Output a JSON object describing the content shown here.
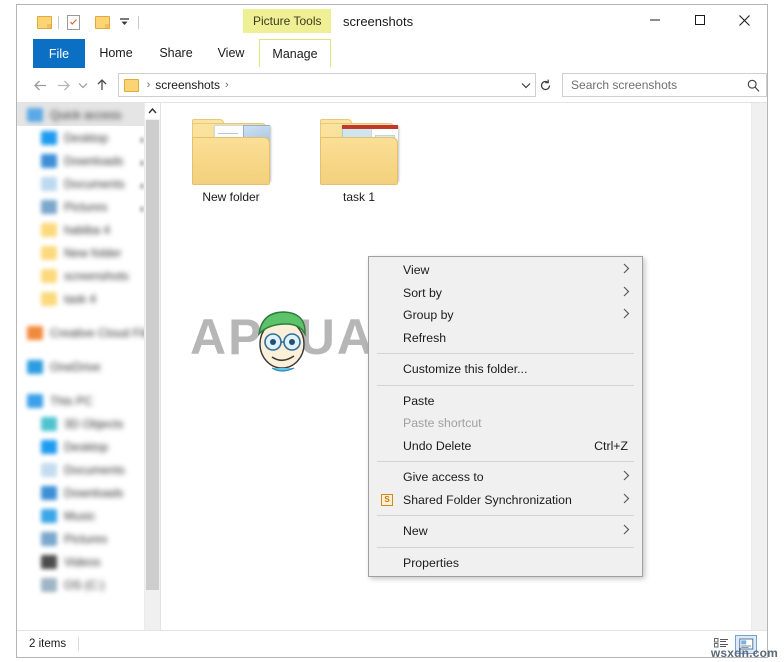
{
  "window": {
    "title": "screenshots",
    "contextual_tab_group": "Picture Tools",
    "controls": {
      "minimize": "—",
      "maximize": "□",
      "close": "✕",
      "ribbon_collapse": "⌄",
      "help": "?"
    }
  },
  "quick_access_toolbar": {
    "items": [
      {
        "name": "folder-icon",
        "label": ""
      },
      {
        "name": "properties-icon",
        "label": ""
      },
      {
        "name": "new-folder-icon",
        "label": ""
      },
      {
        "name": "customize-dropdown-icon",
        "label": "▾"
      }
    ]
  },
  "ribbon": {
    "tabs": [
      {
        "label": "File",
        "state": "file"
      },
      {
        "label": "Home",
        "state": "normal"
      },
      {
        "label": "Share",
        "state": "normal"
      },
      {
        "label": "View",
        "state": "normal"
      },
      {
        "label": "Manage",
        "state": "contextual"
      }
    ]
  },
  "navigation": {
    "back": "←",
    "forward": "→",
    "recent": "⌄",
    "up": "↑"
  },
  "address_bar": {
    "crumbs": [
      "screenshots"
    ],
    "separator": "›",
    "dropdown": "⌄",
    "refresh": "↻"
  },
  "search": {
    "placeholder": "Search screenshots",
    "icon": "⚲"
  },
  "nav_pane": {
    "items": [
      {
        "label": "Quick access",
        "level": 0,
        "icon_color": "#5aa9e6",
        "selected": true,
        "pinned": false
      },
      {
        "label": "Desktop",
        "level": 1,
        "icon_color": "#1e9bf0",
        "selected": false,
        "pinned": true
      },
      {
        "label": "Downloads",
        "level": 1,
        "icon_color": "#3d8fd6",
        "selected": false,
        "pinned": true
      },
      {
        "label": "Documents",
        "level": 1,
        "icon_color": "#bcd9ef",
        "selected": false,
        "pinned": true
      },
      {
        "label": "Pictures",
        "level": 1,
        "icon_color": "#7aa7cc",
        "selected": false,
        "pinned": true
      },
      {
        "label": "habiba 4",
        "level": 1,
        "icon_color": "#fbd97c",
        "selected": false,
        "pinned": false
      },
      {
        "label": "New folder",
        "level": 1,
        "icon_color": "#fbd97c",
        "selected": false,
        "pinned": false
      },
      {
        "label": "screenshots",
        "level": 1,
        "icon_color": "#fbd97c",
        "selected": false,
        "pinned": false
      },
      {
        "label": "task 4",
        "level": 1,
        "icon_color": "#fbd97c",
        "selected": false,
        "pinned": false
      },
      {
        "label": "Creative Cloud Files",
        "level": 0,
        "icon_color": "#f08a3c",
        "selected": false,
        "pinned": false
      },
      {
        "label": "OneDrive",
        "level": 0,
        "icon_color": "#2b9de0",
        "selected": false,
        "pinned": false
      },
      {
        "label": "This PC",
        "level": 0,
        "icon_color": "#3aa0ea",
        "selected": false,
        "pinned": false
      },
      {
        "label": "3D Objects",
        "level": 1,
        "icon_color": "#4fc3d0",
        "selected": false,
        "pinned": false
      },
      {
        "label": "Desktop",
        "level": 1,
        "icon_color": "#1e9bf0",
        "selected": false,
        "pinned": false
      },
      {
        "label": "Documents",
        "level": 1,
        "icon_color": "#c4dcef",
        "selected": false,
        "pinned": false
      },
      {
        "label": "Downloads",
        "level": 1,
        "icon_color": "#3d8fd6",
        "selected": false,
        "pinned": false
      },
      {
        "label": "Music",
        "level": 1,
        "icon_color": "#3aa6e8",
        "selected": false,
        "pinned": false
      },
      {
        "label": "Pictures",
        "level": 1,
        "icon_color": "#7aa7cc",
        "selected": false,
        "pinned": false
      },
      {
        "label": "Videos",
        "level": 1,
        "icon_color": "#4c4c4c",
        "selected": false,
        "pinned": false
      },
      {
        "label": "OS (C:)",
        "level": 1,
        "icon_color": "#9fb4c4",
        "selected": false,
        "pinned": false
      }
    ]
  },
  "files": [
    {
      "name": "New folder",
      "type": "folder"
    },
    {
      "name": "task 1",
      "type": "folder"
    }
  ],
  "context_menu": [
    {
      "label": "View",
      "type": "submenu",
      "accel": "",
      "icon": ""
    },
    {
      "label": "Sort by",
      "type": "submenu",
      "accel": "",
      "icon": ""
    },
    {
      "label": "Group by",
      "type": "submenu",
      "accel": "",
      "icon": ""
    },
    {
      "label": "Refresh",
      "type": "item",
      "accel": "",
      "icon": ""
    },
    {
      "type": "separator"
    },
    {
      "label": "Customize this folder...",
      "type": "item",
      "accel": "",
      "icon": ""
    },
    {
      "type": "separator"
    },
    {
      "label": "Paste",
      "type": "item",
      "accel": "",
      "icon": ""
    },
    {
      "label": "Paste shortcut",
      "type": "disabled",
      "accel": "",
      "icon": ""
    },
    {
      "label": "Undo Delete",
      "type": "item",
      "accel": "Ctrl+Z",
      "icon": ""
    },
    {
      "type": "separator"
    },
    {
      "label": "Give access to",
      "type": "submenu",
      "accel": "",
      "icon": ""
    },
    {
      "label": "Shared Folder Synchronization",
      "type": "submenu",
      "accel": "",
      "icon": "sync-icon"
    },
    {
      "type": "separator"
    },
    {
      "label": "New",
      "type": "submenu",
      "accel": "",
      "icon": ""
    },
    {
      "type": "separator"
    },
    {
      "label": "Properties",
      "type": "item",
      "accel": "",
      "icon": ""
    }
  ],
  "status_bar": {
    "item_count": "2 items",
    "views": [
      {
        "name": "details-view",
        "selected": false
      },
      {
        "name": "large-icons-view",
        "selected": true
      }
    ]
  },
  "watermarks": {
    "brand": "APPUALS",
    "site": "wsxdn.com"
  },
  "colors": {
    "accent_blue": "#0b6fc4",
    "contextual_yellow": "#efef95",
    "folder_yellow": "#fbd97c",
    "menu_bg": "#f0f0f0"
  }
}
